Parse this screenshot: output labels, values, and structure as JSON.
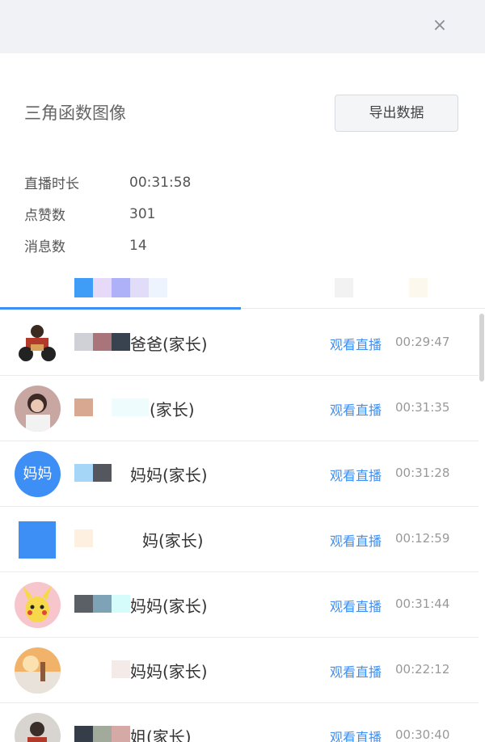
{
  "header": {
    "close_icon": "close-icon",
    "close_glyph": "×"
  },
  "panel": {
    "title": "三角函数图像",
    "export_button": "导出数据",
    "stats": [
      {
        "label": "直播时长",
        "value": "00:31:58"
      },
      {
        "label": "点赞数",
        "value": "301"
      },
      {
        "label": "消息数",
        "value": "14"
      }
    ]
  },
  "colors": {
    "accent": "#3c8ff5",
    "topbar": "#f0f2f5"
  },
  "list": {
    "rows": [
      {
        "name": "爸爸(家长)",
        "action": "观看直播",
        "time": "00:29:47"
      },
      {
        "name": "(家长)",
        "action": "观看直播",
        "time": "00:31:35"
      },
      {
        "name": "妈妈(家长)",
        "action": "观看直播",
        "time": "00:31:28",
        "avatar_text": "妈妈"
      },
      {
        "name": "妈(家长)",
        "action": "观看直播",
        "time": "00:12:59"
      },
      {
        "name": "妈妈(家长)",
        "action": "观看直播",
        "time": "00:31:44"
      },
      {
        "name": "妈妈(家长)",
        "action": "观看直播",
        "time": "00:22:12"
      },
      {
        "name": "姐(家长)",
        "action": "观看直播",
        "time": "00:30:40"
      }
    ]
  }
}
